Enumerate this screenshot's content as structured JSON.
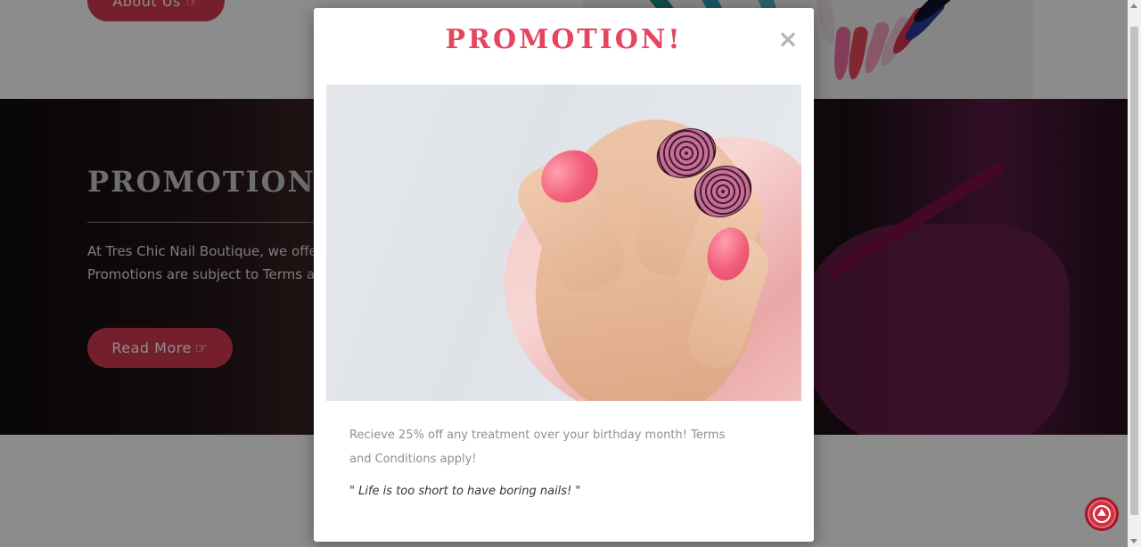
{
  "background_page": {
    "about_button_label": "About Us",
    "promo_heading": "PROMOTION!",
    "promo_text_line1": "At Tres Chic Nail Boutique, we offe",
    "promo_text_line2": "Promotions are subject to Terms a",
    "read_more_label": "Read More"
  },
  "modal": {
    "title": "PROMOTION!",
    "close_symbol": "×",
    "body_text": "Recieve 25% off any treatment over your birthday month! Terms and Conditions apply!",
    "quote": "\" Life is too short to have boring nails! \""
  },
  "colors": {
    "accent": "#e5455f",
    "button": "#d63a52",
    "back_to_top": "#d22f3f"
  },
  "icons": {
    "about_button_icon": "hand-pointer-icon",
    "read_more_icon": "hand-pointer-icon",
    "close_icon": "close-icon",
    "back_to_top_icon": "arrow-up-icon"
  }
}
